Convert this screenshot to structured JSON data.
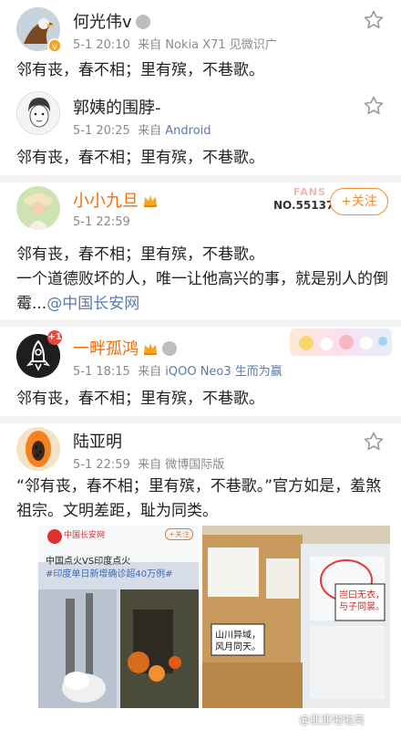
{
  "posts": [
    {
      "username": "何光伟v",
      "time": "5-1 20:10",
      "source_prefix": "来自",
      "device": "Nokia X71 见微识广",
      "text": "邻有丧，春不相；里有殡，不巷歌。"
    },
    {
      "username": "郭姨的围脖-",
      "time": "5-1 20:25",
      "source_prefix": "来自",
      "device": "Android",
      "text": "邻有丧，春不相；里有殡，不巷歌。"
    },
    {
      "username": "小小九旦",
      "time": "5-1 22:59",
      "fans_label": "FANS",
      "fans_number": "NO.551370",
      "follow_label": "+关注",
      "text_line1": "邻有丧，春不相；里有殡，不巷歌。",
      "text_line2": "一个道德败坏的人，唯一让他高兴的事，就是别人的倒霉...",
      "mention": "@中国长安网"
    },
    {
      "username": "一畔孤鸿",
      "notification_count": "+1",
      "time": "5-1 18:15",
      "source_prefix": "来自",
      "device": "iQOO Neo3 生而为赢",
      "text": "邻有丧，春不相；里有殡，不巷歌。"
    },
    {
      "username": "陆亚明",
      "time": "5-1 22:59",
      "source_prefix": "来自",
      "device": "微博国际版",
      "text": "“邻有丧，春不相；里有殡，不巷歌。”官方如是，羞煞祖宗。文明差距，耻为同类。",
      "image_left": {
        "account": "中国长安网",
        "follow": "+关注",
        "headline": "中国点火VS印度点火",
        "hashtag": "#印度单日新增确诊超40万例#"
      },
      "image_right": {
        "sign1_line1": "山川异域，",
        "sign1_line2": "风月同天。",
        "sign2_line1": "岂曰无衣，",
        "sign2_line2": "与子同裳。"
      }
    }
  ],
  "watermark": "@亚亚啦啦亮",
  "colors": {
    "link": "#5a7bab",
    "vip_name": "#f06e0c",
    "follow": "#f28c30",
    "divider": "#f2f2f2"
  }
}
